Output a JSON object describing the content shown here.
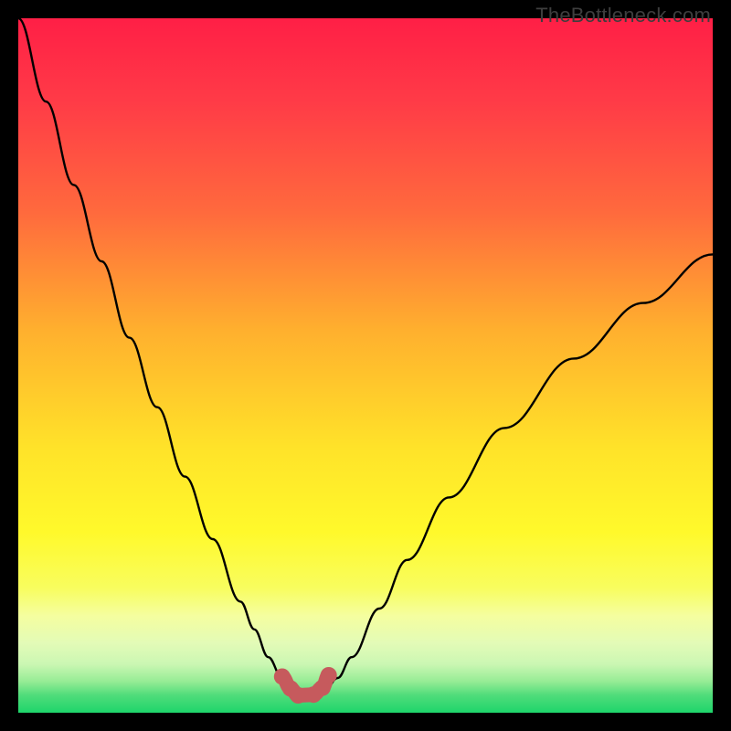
{
  "watermark": "TheBottleneck.com",
  "colors": {
    "black": "#000000",
    "curve_black": "#000000",
    "pink_marker": "#c65a5d",
    "gradient_stops": [
      {
        "offset": 0.0,
        "color": "#ff1f46"
      },
      {
        "offset": 0.12,
        "color": "#ff3b47"
      },
      {
        "offset": 0.28,
        "color": "#ff6a3d"
      },
      {
        "offset": 0.45,
        "color": "#ffb02e"
      },
      {
        "offset": 0.62,
        "color": "#ffe329"
      },
      {
        "offset": 0.74,
        "color": "#fff92b"
      },
      {
        "offset": 0.82,
        "color": "#f8fd5e"
      },
      {
        "offset": 0.86,
        "color": "#f5fe9f"
      },
      {
        "offset": 0.9,
        "color": "#e3fbb7"
      },
      {
        "offset": 0.93,
        "color": "#cbf7b3"
      },
      {
        "offset": 0.955,
        "color": "#96ec95"
      },
      {
        "offset": 0.975,
        "color": "#4fdc7a"
      },
      {
        "offset": 1.0,
        "color": "#1ed56b"
      }
    ]
  },
  "chart_data": {
    "type": "line",
    "title": "",
    "xlabel": "",
    "ylabel": "",
    "xlim": [
      0,
      100
    ],
    "ylim": [
      0,
      100
    ],
    "grid": false,
    "legend": false,
    "annotations": [],
    "series": [
      {
        "name": "bottleneck-curve",
        "x": [
          0,
          4,
          8,
          12,
          16,
          20,
          24,
          28,
          32,
          34,
          36,
          38,
          39,
          40,
          41,
          42,
          43,
          44,
          46,
          48,
          52,
          56,
          62,
          70,
          80,
          90,
          100
        ],
        "y": [
          100,
          88,
          76,
          65,
          54,
          44,
          34,
          25,
          16,
          12,
          8,
          5,
          3.5,
          2.5,
          2,
          2,
          2.5,
          3,
          5,
          8,
          15,
          22,
          31,
          41,
          51,
          59,
          66
        ]
      }
    ],
    "markers": {
      "name": "bottom-markers",
      "x": [
        38,
        39.2,
        40.3,
        42.5,
        43.8,
        44.7
      ],
      "y": [
        5.2,
        3.5,
        2.5,
        2.6,
        3.6,
        5.4
      ]
    },
    "note": "x/y are in percent of the 0–100 axis range; y=0 at bottom"
  }
}
